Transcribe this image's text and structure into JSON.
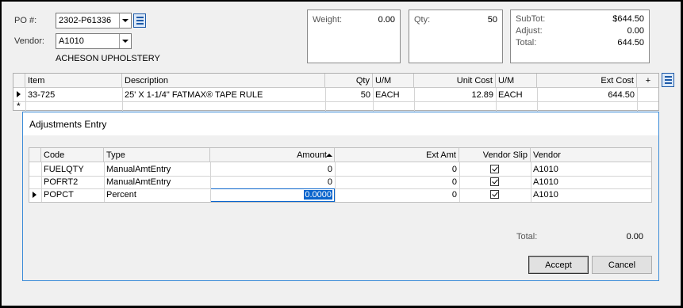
{
  "header": {
    "po_label": "PO #:",
    "po_value": "2302-P61336",
    "vendor_label": "Vendor:",
    "vendor_value": "A1010",
    "vendor_name": "ACHESON UPHOLSTERY"
  },
  "summary": {
    "weight_label": "Weight:",
    "weight_value": "0.00",
    "qty_label": "Qty:",
    "qty_value": "50",
    "subtot_label": "SubTot:",
    "subtot_value": "$644.50",
    "adjust_label": "Adjust:",
    "adjust_value": "0.00",
    "total_label": "Total:",
    "total_value": "644.50"
  },
  "items_grid": {
    "columns": [
      "Item",
      "Description",
      "Qty",
      "U/M",
      "Unit Cost",
      "U/M",
      "Ext Cost",
      "+"
    ],
    "rows": [
      {
        "item": "33-725",
        "description": "25' X 1-1/4\" FATMAX® TAPE RULE",
        "qty": "50",
        "um": "EACH",
        "unit_cost": "12.89",
        "um2": "EACH",
        "ext_cost": "644.50"
      }
    ],
    "new_row_marker": "*"
  },
  "dialog": {
    "title": "Adjustments Entry",
    "columns": [
      "Code",
      "Type",
      "Amount",
      "Ext Amt",
      "Vendor Slip",
      "Vendor"
    ],
    "rows": [
      {
        "code": "FUELQTY",
        "type": "ManualAmtEntry",
        "amount": "0",
        "ext_amt": "0",
        "vendor_slip": true,
        "vendor": "A1010"
      },
      {
        "code": "POFRT2",
        "type": "ManualAmtEntry",
        "amount": "0",
        "ext_amt": "0",
        "vendor_slip": true,
        "vendor": "A1010"
      },
      {
        "code": "POPCT",
        "type": "Percent",
        "amount": "0.0000",
        "ext_amt": "0",
        "vendor_slip": true,
        "vendor": "A1010"
      }
    ],
    "total_label": "Total:",
    "total_value": "0.00",
    "accept_label": "Accept",
    "cancel_label": "Cancel"
  }
}
